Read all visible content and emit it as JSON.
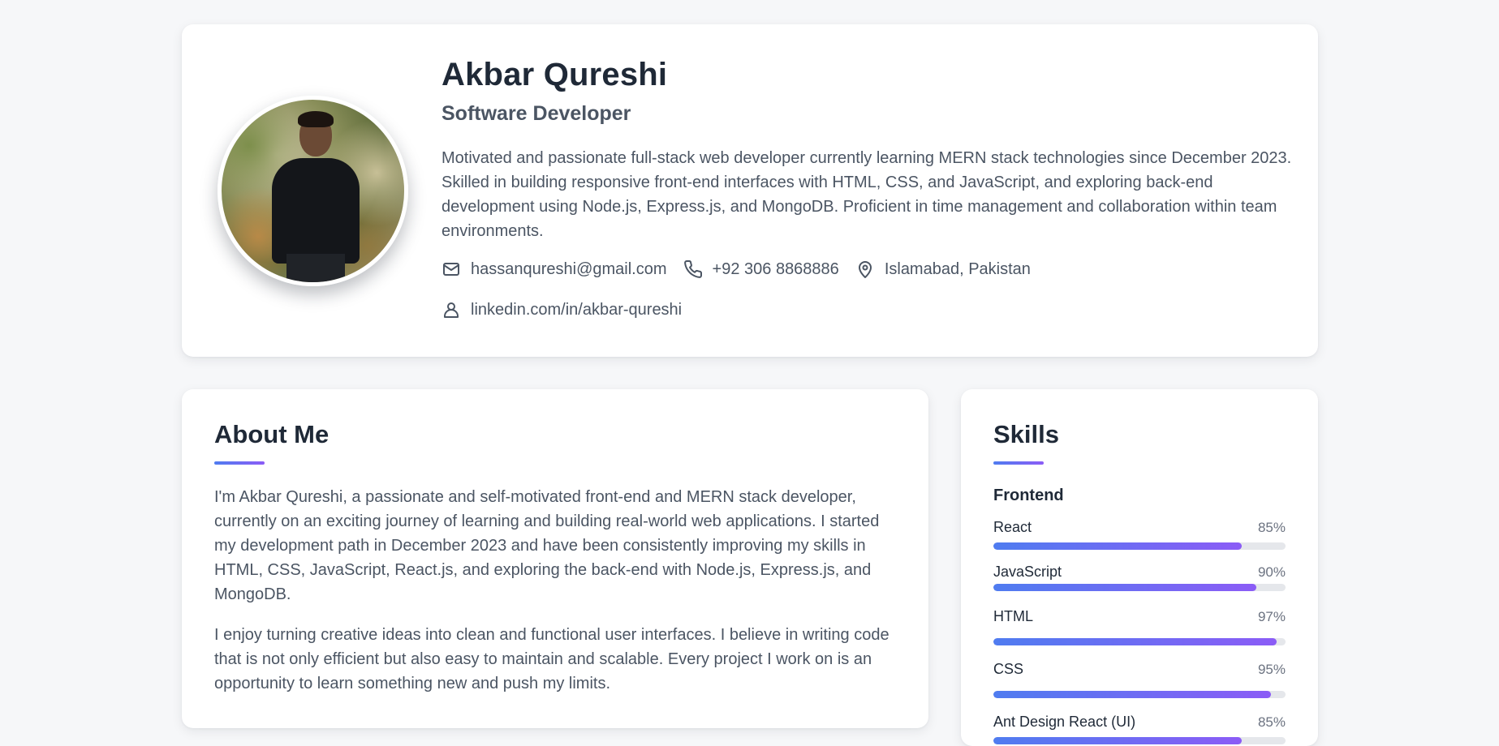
{
  "profile": {
    "name": "Akbar Qureshi",
    "role": "Software Developer",
    "summary": "Motivated and passionate full-stack web developer currently learning MERN stack technologies since December 2023. Skilled in building responsive front-end interfaces with HTML, CSS, and JavaScript, and exploring back-end development using Node.js, Express.js, and MongoDB. Proficient in time management and collaboration within team environments.",
    "contacts": {
      "email": {
        "icon": "mail-icon",
        "text": "hassanqureshi@gmail.com"
      },
      "phone": {
        "icon": "phone-icon",
        "text": "+92 306 8868886"
      },
      "location": {
        "icon": "map-pin-icon",
        "text": "Islamabad, Pakistan"
      },
      "linkedin": {
        "icon": "user-icon",
        "text": "linkedin.com/in/akbar-qureshi"
      }
    }
  },
  "about": {
    "title": "About Me",
    "paragraphs": [
      "I'm Akbar Qureshi, a passionate and self-motivated front-end and MERN stack developer, currently on an exciting journey of learning and building real-world web applications. I started my development path in December 2023 and have been consistently improving my skills in HTML, CSS, JavaScript, React.js, and exploring the back-end with Node.js, Express.js, and MongoDB.",
      "I enjoy turning creative ideas into clean and functional user interfaces. I believe in writing code that is not only efficient but also easy to maintain and scalable. Every project I work on is an opportunity to learn something new and push my limits."
    ]
  },
  "skills": {
    "title": "Skills",
    "groups": [
      {
        "title": "Frontend",
        "items": [
          {
            "name": "React",
            "percent_label": "85%",
            "level": 0.85
          },
          {
            "name": "JavaScript",
            "percent_label": "90%",
            "level": 0.9
          },
          {
            "name": "HTML",
            "percent_label": "97%",
            "level": 0.97
          },
          {
            "name": "CSS",
            "percent_label": "95%",
            "level": 0.95
          },
          {
            "name": "Ant Design React (UI)",
            "percent_label": "85%",
            "level": 0.85
          }
        ]
      }
    ]
  },
  "colors": {
    "accent_start": "#4f7cf0",
    "accent_end": "#8b5cf6",
    "page_background": "#f6f7f9"
  }
}
